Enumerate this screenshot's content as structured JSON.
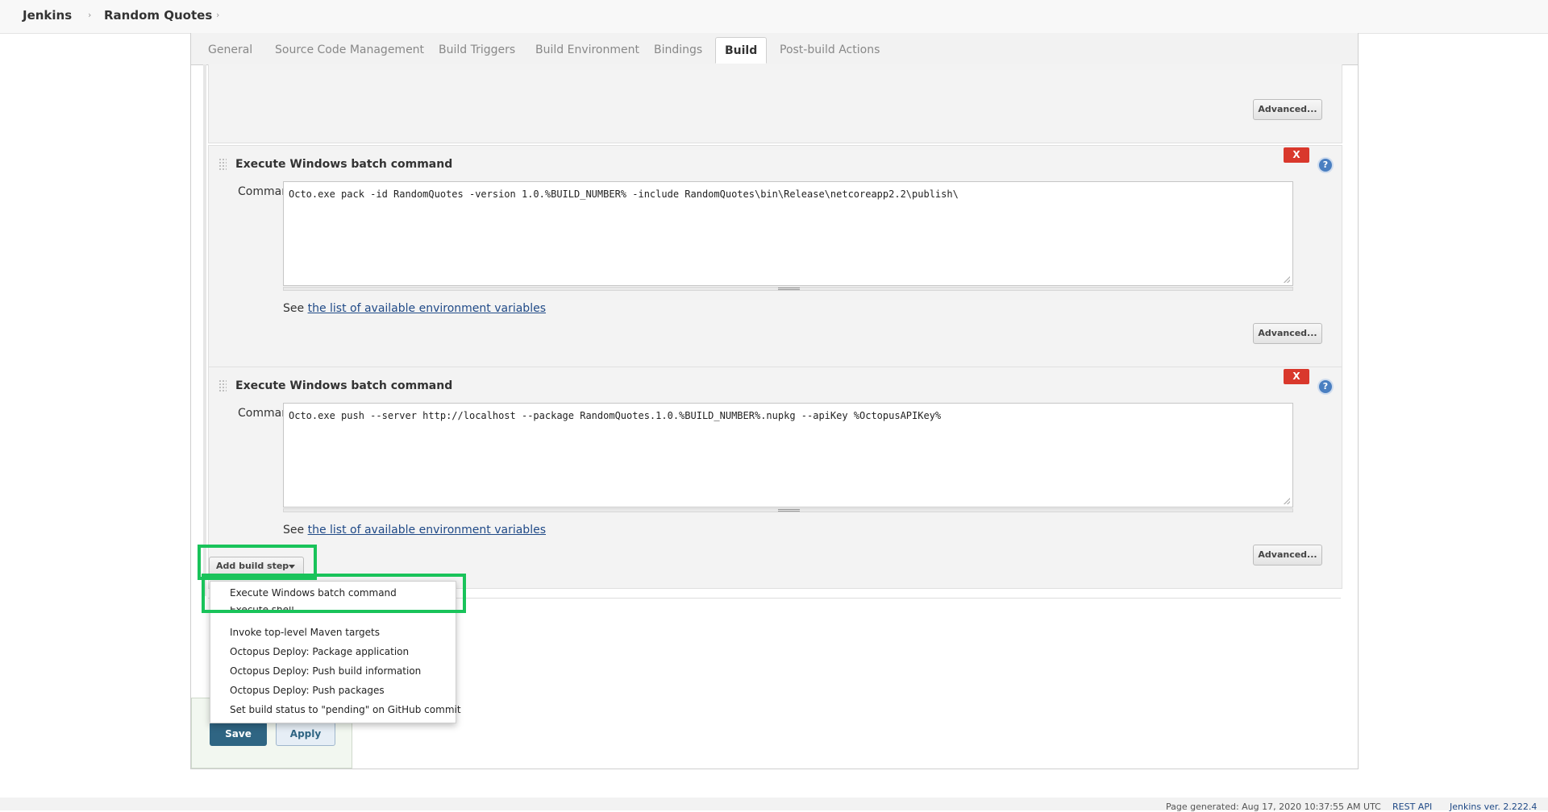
{
  "breadcrumb": {
    "items": [
      "Jenkins",
      "Random Quotes"
    ],
    "separator": "›"
  },
  "tabs": [
    "General",
    "Source Code Management",
    "Build Triggers",
    "Build Environment",
    "Bindings",
    "Build",
    "Post-build Actions"
  ],
  "active_tab": "Build",
  "steps": [
    {
      "title": "Execute Windows batch command",
      "command_label": "Command",
      "command": "Octo.exe pack -id RandomQuotes -version 1.0.%BUILD_NUMBER% -include RandomQuotes\\bin\\Release\\netcoreapp2.2\\publish\\",
      "see_prefix": "See ",
      "see_link": "the list of available environment variables",
      "advanced_label": "Advanced...",
      "delete_label": "X",
      "help_label": "?"
    },
    {
      "title": "Execute Windows batch command",
      "command_label": "Command",
      "command": "Octo.exe push --server http://localhost --package RandomQuotes.1.0.%BUILD_NUMBER%.nupkg --apiKey %OctopusAPIKey%",
      "see_prefix": "See ",
      "see_link": "the list of available environment variables",
      "advanced_label": "Advanced...",
      "delete_label": "X",
      "help_label": "?"
    }
  ],
  "prev_advanced_label": "Advanced...",
  "add_build_step_label": "Add build step",
  "menu_items": [
    "Execute Windows batch command",
    "Execute shell",
    "Invoke top-level Maven targets",
    "Octopus Deploy: Package application",
    "Octopus Deploy: Push build information",
    "Octopus Deploy: Push packages",
    "Set build status to \"pending\" on GitHub commit"
  ],
  "buttons": {
    "save": "Save",
    "apply": "Apply"
  },
  "footer": {
    "generated": "Page generated: Aug 17, 2020 10:37:55 AM UTC",
    "rest_api": "REST API",
    "version": "Jenkins ver. 2.222.4"
  },
  "colors": {
    "highlight": "#19c35a",
    "delete": "#d9382c",
    "save": "#2f6583",
    "link": "#204a87"
  }
}
